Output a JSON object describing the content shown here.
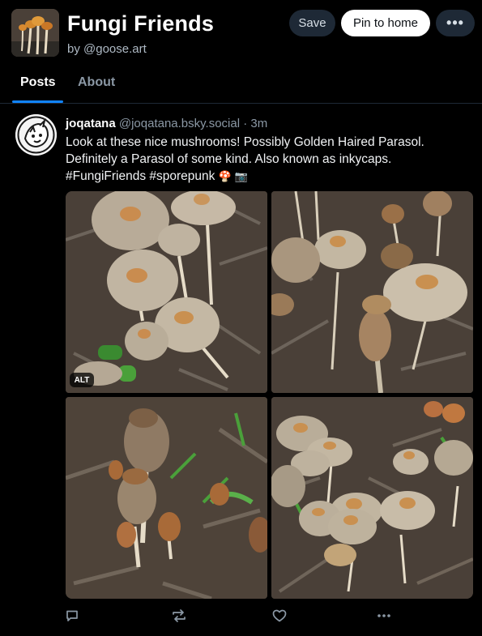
{
  "feed": {
    "title": "Fungi Friends",
    "author": "by @goose.art",
    "avatar_icon": "mushroom-avatar-icon"
  },
  "actions": {
    "save_label": "Save",
    "pin_label": "Pin to home",
    "more_label": "•••"
  },
  "tabs": [
    {
      "label": "Posts",
      "active": true
    },
    {
      "label": "About",
      "active": false
    }
  ],
  "post": {
    "display_name": "joqatana",
    "handle": "@joqatana.bsky.social",
    "separator": "·",
    "time": "3m",
    "text": "Look at these nice mushrooms! Possibly Golden Haired Parasol. Definitely a Parasol of some kind. Also known as inkycaps. #FungiFriends #sporepunk",
    "emoji": "🍄 📷",
    "alt_badge": "ALT",
    "images": [
      {
        "icon": "mushroom-photo-1"
      },
      {
        "icon": "mushroom-photo-2"
      },
      {
        "icon": "mushroom-photo-3"
      },
      {
        "icon": "mushroom-photo-4"
      }
    ],
    "buttons": [
      "reply-icon",
      "repost-icon",
      "like-icon",
      "more-icon"
    ]
  },
  "colors": {
    "background": "#000000",
    "accent": "#1083fe",
    "muted": "#8b98a5",
    "button_dark": "#1e2936"
  }
}
